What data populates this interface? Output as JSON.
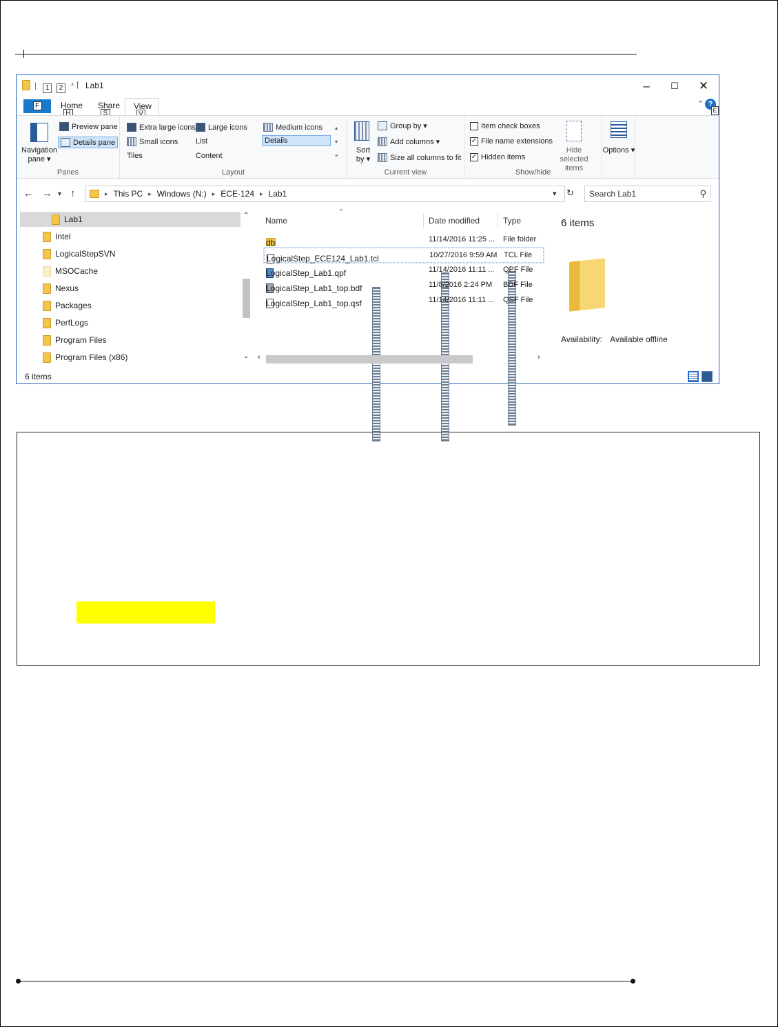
{
  "window": {
    "title": "Lab1",
    "quick_access_keys": [
      "1",
      "2"
    ],
    "controls": {
      "minimize": "–",
      "maximize": "☐",
      "close": "✕"
    }
  },
  "ribbon_tabs": {
    "file_key": "F",
    "tabs": [
      {
        "label": "Home",
        "key": "H"
      },
      {
        "label": "Share",
        "key": "S"
      },
      {
        "label": "View",
        "key": "V"
      }
    ],
    "help_key": "E"
  },
  "ribbon": {
    "panes": {
      "label": "Panes",
      "navigation_pane": "Navigation pane ▾",
      "preview_pane": "Preview pane",
      "details_pane": "Details pane"
    },
    "layout": {
      "label": "Layout",
      "items": [
        "Extra large icons",
        "Large icons",
        "Medium icons",
        "Small icons",
        "List",
        "Details",
        "Tiles",
        "Content"
      ]
    },
    "current_view": {
      "label": "Current view",
      "sort_by": "Sort by ▾",
      "group_by": "Group by ▾",
      "add_columns": "Add columns ▾",
      "size_columns": "Size all columns to fit"
    },
    "show_hide": {
      "label": "Show/hide",
      "item_check_boxes": {
        "label": "Item check boxes",
        "checked": false
      },
      "file_name_extensions": {
        "label": "File name extensions",
        "checked": true
      },
      "hidden_items": {
        "label": "Hidden items",
        "checked": true
      },
      "hide_selected": "Hide selected items"
    },
    "options": "Options ▾"
  },
  "address": {
    "crumbs": [
      "This PC",
      "Windows (N:)",
      "ECE-124",
      "Lab1"
    ],
    "search_placeholder": "Search Lab1"
  },
  "nav_pane": {
    "items": [
      "Lab1",
      "Intel",
      "LogicalStepSVN",
      "MSOCache",
      "Nexus",
      "Packages",
      "PerfLogs",
      "Program Files",
      "Program Files (x86)"
    ]
  },
  "file_list": {
    "columns": [
      "Name",
      "Date modified",
      "Type"
    ],
    "rows": [
      {
        "name": "db",
        "date": "11/14/2016 11:25 ...",
        "type": "File folder",
        "kind": "folder"
      },
      {
        "name": "LogicalStep_ECE124_Lab1.tcl",
        "date": "10/27/2016 9:59 AM",
        "type": "TCL File",
        "kind": "file"
      },
      {
        "name": "LogicalStep_Lab1.qpf",
        "date": "11/14/2016 11:11 ...",
        "type": "QPF File",
        "kind": "qpf"
      },
      {
        "name": "LogicalStep_Lab1_top.bdf",
        "date": "11/8/2016 2:24 PM",
        "type": "BDF File",
        "kind": "bdf"
      },
      {
        "name": "LogicalStep_Lab1_top.qsf",
        "date": "11/14/2016 11:11 ...",
        "type": "QSF File",
        "kind": "file"
      }
    ]
  },
  "details_pane": {
    "count": "6 items",
    "availability_label": "Availability:",
    "availability_value": "Available offline"
  },
  "status_bar": {
    "count": "6 items"
  },
  "colors": {
    "accent": "#1979ca",
    "highlight": "#ffff00",
    "folder": "#f3c64a"
  }
}
